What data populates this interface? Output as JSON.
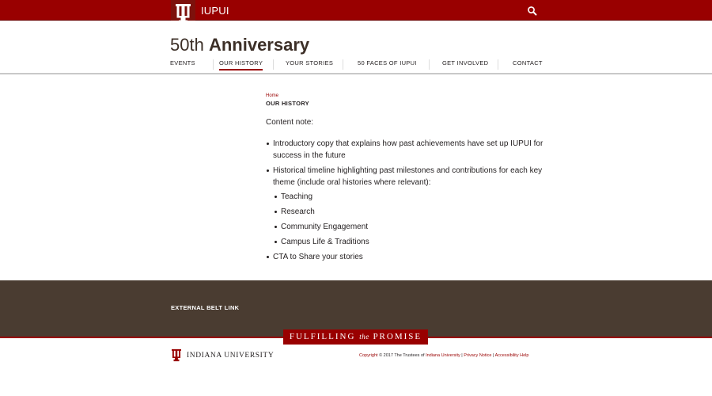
{
  "colors": {
    "crimson": "#990000",
    "dark_crimson": "#7d110c",
    "belt_brown": "#4a3c31",
    "text": "#231f20"
  },
  "topbar": {
    "site_name": "IUPUI",
    "logo_icon": "trident-icon",
    "search_icon": "search-icon"
  },
  "header": {
    "title_light": "50th",
    "title_bold": "Anniversary",
    "nav": [
      {
        "label": "EVENTS",
        "active": false
      },
      {
        "label": "OUR HISTORY",
        "active": true
      },
      {
        "label": "YOUR STORIES",
        "active": false
      },
      {
        "label": "50 FACES OF IUPUI",
        "active": false
      },
      {
        "label": "GET INVOLVED",
        "active": false
      },
      {
        "label": "CONTACT",
        "active": false
      }
    ]
  },
  "main": {
    "breadcrumb": "Home",
    "title": "OUR HISTORY",
    "note": "Content note:",
    "items": [
      {
        "text": "Introductory copy that explains how past achievements have set up IUPUI for success in the future"
      },
      {
        "text": "Historical timeline highlighting past milestones and contributions for each key theme (include oral histories where relevant):",
        "sub": [
          "Teaching",
          "Research",
          "Community Engagement",
          "Campus Life & Traditions"
        ]
      },
      {
        "text": "CTA to Share your stories"
      }
    ]
  },
  "belt": {
    "link": "EXTERNAL BELT LINK"
  },
  "promise": {
    "part1": "FULFILLING",
    "part2": "the",
    "part3": "PROMISE"
  },
  "footer": {
    "university": "INDIANA UNIVERSITY",
    "copyright_link": "Copyright",
    "copyright_text": " © 2017 The Trustees of ",
    "iu_link": "Indiana University",
    "sep1": " | ",
    "privacy": "Privacy Notice",
    "sep2": " | ",
    "accessibility": "Accessibility Help"
  }
}
